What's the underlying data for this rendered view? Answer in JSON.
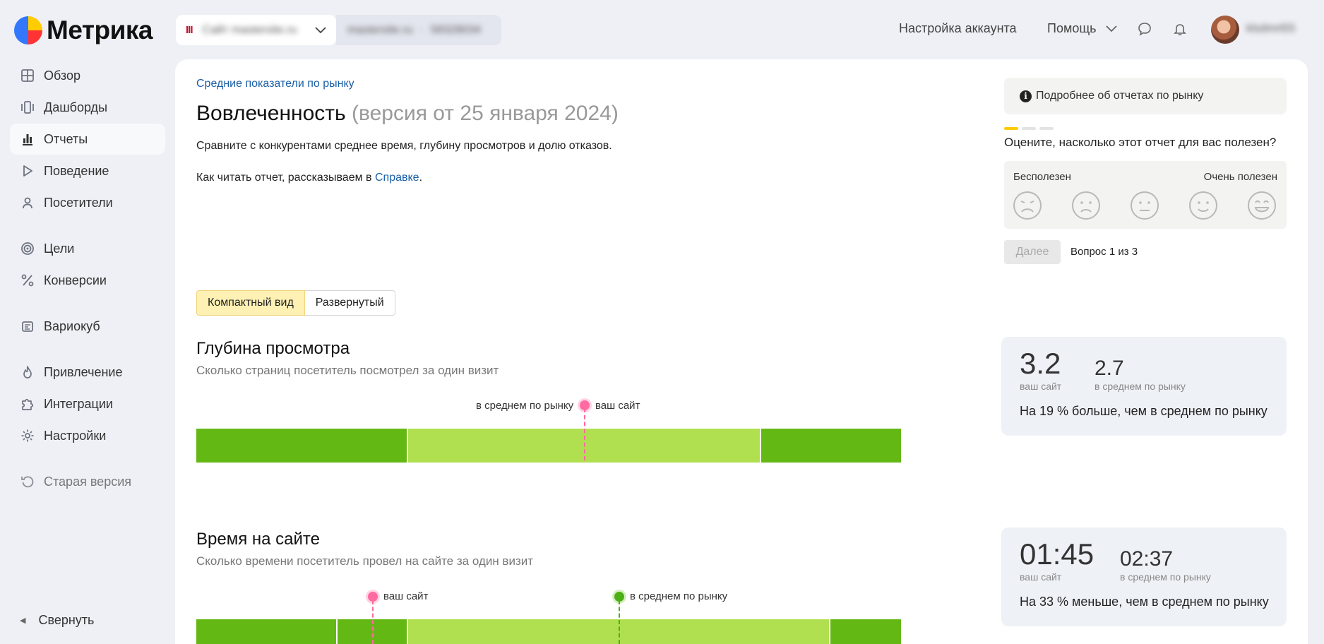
{
  "header": {
    "logo_text": "Метрика",
    "counter_name": "Сайт mastersite.ru",
    "counter_domain": "mastersite.ru",
    "counter_id": "58328034",
    "account_settings": "Настройка аккаунта",
    "help": "Помощь",
    "username": "klsdmrt55"
  },
  "sidebar": {
    "items": [
      {
        "label": "Обзор",
        "icon": "grid-icon"
      },
      {
        "label": "Дашборды",
        "icon": "dashboards-icon"
      },
      {
        "label": "Отчеты",
        "icon": "reports-icon",
        "active": true
      },
      {
        "label": "Поведение",
        "icon": "play-icon"
      },
      {
        "label": "Посетители",
        "icon": "user-icon"
      },
      {
        "label": "Цели",
        "icon": "target-icon"
      },
      {
        "label": "Конверсии",
        "icon": "percent-icon"
      },
      {
        "label": "Вариокуб",
        "icon": "cube-icon"
      },
      {
        "label": "Привлечение",
        "icon": "fire-icon"
      },
      {
        "label": "Интеграции",
        "icon": "puzzle-icon"
      },
      {
        "label": "Настройки",
        "icon": "gear-icon"
      },
      {
        "label": "Старая версия",
        "icon": "undo-icon"
      }
    ],
    "collapse": "Свернуть"
  },
  "page": {
    "breadcrumb": "Средние показатели по рынку",
    "title": "Вовлеченность",
    "title_version": "(версия от 25 января 2024)",
    "description": "Сравните с конкурентами среднее время, глубину просмотров и долю отказов.",
    "howto_prefix": "Как читать отчет, рассказываем в ",
    "howto_link": "Справке",
    "howto_suffix": ".",
    "view_compact": "Компактный вид",
    "view_expanded": "Развернутый"
  },
  "metrics": [
    {
      "title": "Глубина просмотра",
      "subtitle": "Сколько страниц посетитель посмотрел за один визит",
      "market_label": "в среднем по рынку",
      "site_label": "ваш сайт",
      "site_value": "3.2",
      "site_caption": "ваш сайт",
      "market_value": "2.7",
      "market_caption": "в среднем по рынку",
      "comparison": "На 19 % больше, чем в среднем по рынку"
    },
    {
      "title": "Время на сайте",
      "subtitle": "Сколько времени посетитель провел на сайте за один визит",
      "market_label": "в среднем по рынку",
      "site_label": "ваш сайт",
      "site_value": "01:45",
      "site_caption": "ваш сайт",
      "market_value": "02:37",
      "market_caption": "в среднем по рынку",
      "comparison": "На 33 % меньше, чем в среднем по рынку"
    }
  ],
  "feedback": {
    "info": "Подробнее об отчетах по рынку",
    "question": "Оцените, насколько этот отчет для вас полезен?",
    "min_label": "Бесполезен",
    "max_label": "Очень полезен",
    "next": "Далее",
    "counter": "Вопрос 1 из 3"
  },
  "colors": {
    "bar_dark": "#64b814",
    "bar_light": "#b0e050",
    "site_marker": "#ff6aa0",
    "market_marker": "#4caf16",
    "accent_yellow": "#fff0b3",
    "link": "#1a5fa8"
  }
}
